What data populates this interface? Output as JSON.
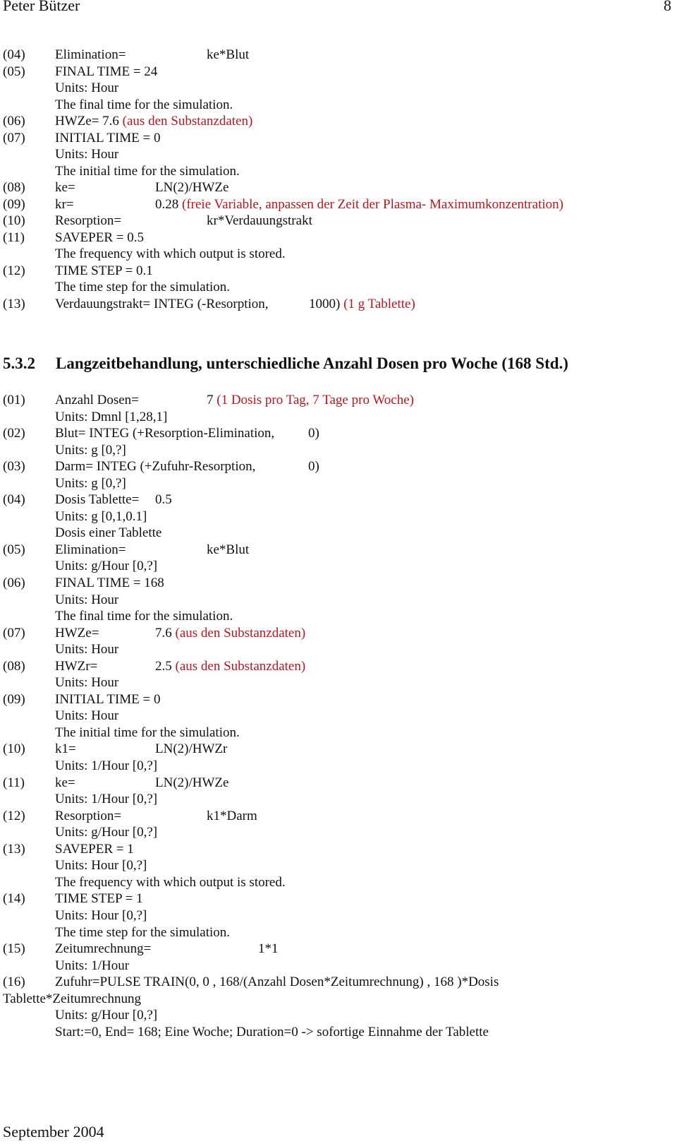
{
  "header": {
    "author": "Peter Bützer",
    "page_number": "8"
  },
  "section1": {
    "lines": [
      {
        "num": "(04)",
        "text": "Elimination=",
        "value": "ke*Blut",
        "value_col": "far",
        "note": ""
      },
      {
        "num": "(05)",
        "text": "FINAL TIME  = 24",
        "value": "",
        "note": ""
      },
      {
        "num": "",
        "text": "Units: Hour",
        "value": "",
        "note": ""
      },
      {
        "num": "",
        "text": "The final time for the simulation.",
        "value": "",
        "note": ""
      },
      {
        "num": "(06)",
        "text": "HWZe= 7.6",
        "value": "",
        "note": "(aus den Substanzdaten)"
      },
      {
        "num": "(07)",
        "text": "INITIAL TIME  = 0",
        "value": "",
        "note": ""
      },
      {
        "num": "",
        "text": "Units: Hour",
        "value": "",
        "note": ""
      },
      {
        "num": "",
        "text": "The initial time for the simulation.",
        "value": "",
        "note": ""
      },
      {
        "num": "(08)",
        "text": "ke=",
        "value": "LN(2)/HWZe",
        "value_col": "mid",
        "note": ""
      },
      {
        "num": "(09)",
        "text": "kr=",
        "value": "0.28",
        "value_col": "mid",
        "note": "(freie Variable, anpassen der Zeit der Plasma- Maximumkonzentration)"
      },
      {
        "num": "(10)",
        "text": "Resorption=",
        "value": "kr*Verdauungstrakt",
        "value_col": "far",
        "note": ""
      },
      {
        "num": "(11)",
        "text": "SAVEPER  = 0.5",
        "value": "",
        "note": ""
      },
      {
        "num": "",
        "text": "The frequency with which output is stored.",
        "value": "",
        "note": ""
      },
      {
        "num": "(12)",
        "text": "TIME STEP  = 0.1",
        "value": "",
        "note": ""
      },
      {
        "num": "",
        "text": "The time step for the simulation.",
        "value": "",
        "note": ""
      },
      {
        "num": "(13)",
        "text": "Verdauungstrakt= INTEG (-Resorption,",
        "value": "1000)",
        "value_col": "integ13",
        "note": "(1 g Tablette)"
      }
    ]
  },
  "section2": {
    "heading_number": "5.3.2",
    "heading_title": "Langzeitbehandlung, unterschiedliche Anzahl Dosen pro Woche (168 Std.)",
    "lines": [
      {
        "num": "(01)",
        "text": "Anzahl Dosen=",
        "value": "7",
        "value_col": "far",
        "note": "(1 Dosis pro Tag, 7 Tage pro Woche)"
      },
      {
        "num": "",
        "text": "Units: Dmnl [1,28,1]",
        "value": "",
        "note": ""
      },
      {
        "num": "(02)",
        "text": "Blut= INTEG (+Resorption-Elimination,",
        "value": "0)",
        "value_col": "integ",
        "note": ""
      },
      {
        "num": "",
        "text": "Units: g [0,?]",
        "value": "",
        "note": ""
      },
      {
        "num": "(03)",
        "text": "Darm= INTEG (+Zufuhr-Resorption,",
        "value": "0)",
        "value_col": "integ",
        "note": ""
      },
      {
        "num": "",
        "text": "Units: g [0,?]",
        "value": "",
        "note": ""
      },
      {
        "num": "(04)",
        "text": "Dosis Tablette=",
        "value": "0.5",
        "value_col": "dose",
        "note": ""
      },
      {
        "num": "",
        "text": "Units: g [0,1,0.1]",
        "value": "",
        "note": ""
      },
      {
        "num": "",
        "text": "Dosis einer Tablette",
        "value": "",
        "note": ""
      },
      {
        "num": "(05)",
        "text": "Elimination=",
        "value": "ke*Blut",
        "value_col": "far",
        "note": ""
      },
      {
        "num": "",
        "text": "Units: g/Hour [0,?]",
        "value": "",
        "note": ""
      },
      {
        "num": "(06)",
        "text": "FINAL TIME  = 168",
        "value": "",
        "note": ""
      },
      {
        "num": "",
        "text": "Units: Hour",
        "value": "",
        "note": ""
      },
      {
        "num": "",
        "text": "The final time for the simulation.",
        "value": "",
        "note": ""
      },
      {
        "num": "(07)",
        "text": "HWZe=",
        "value": "7.6",
        "value_col": "mid",
        "note": "(aus den Substanzdaten)"
      },
      {
        "num": "",
        "text": "Units: Hour",
        "value": "",
        "note": ""
      },
      {
        "num": "(08)",
        "text": "HWZr=",
        "value": "2.5",
        "value_col": "mid",
        "note": "(aus den Substanzdaten)"
      },
      {
        "num": "",
        "text": "Units: Hour",
        "value": "",
        "note": ""
      },
      {
        "num": "(09)",
        "text": "INITIAL TIME  = 0",
        "value": "",
        "note": ""
      },
      {
        "num": "",
        "text": "Units: Hour",
        "value": "",
        "note": ""
      },
      {
        "num": "",
        "text": "The initial time for the simulation.",
        "value": "",
        "note": ""
      },
      {
        "num": "(10)",
        "text": "k1=",
        "value": "LN(2)/HWZr",
        "value_col": "mid",
        "note": ""
      },
      {
        "num": "",
        "text": "Units: 1/Hour [0,?]",
        "value": "",
        "note": ""
      },
      {
        "num": "(11)",
        "text": "ke=",
        "value": "LN(2)/HWZe",
        "value_col": "mid",
        "note": ""
      },
      {
        "num": "",
        "text": "Units: 1/Hour [0,?]",
        "value": "",
        "note": ""
      },
      {
        "num": "(12)",
        "text": "Resorption=",
        "value": "k1*Darm",
        "value_col": "far",
        "note": ""
      },
      {
        "num": "",
        "text": "Units: g/Hour [0,?]",
        "value": "",
        "note": ""
      },
      {
        "num": "(13)",
        "text": "SAVEPER  = 1",
        "value": "",
        "note": ""
      },
      {
        "num": "",
        "text": "Units: Hour [0,?]",
        "value": "",
        "note": ""
      },
      {
        "num": "",
        "text": "The frequency with which output is stored.",
        "value": "",
        "note": ""
      },
      {
        "num": "(14)",
        "text": "TIME STEP  = 1",
        "value": "",
        "note": ""
      },
      {
        "num": "",
        "text": "Units: Hour [0,?]",
        "value": "",
        "note": ""
      },
      {
        "num": "",
        "text": "The time step for the simulation.",
        "value": "",
        "note": ""
      },
      {
        "num": "(15)",
        "text": "Zeitumrechnung=",
        "value": "1*1",
        "value_col": "zeit",
        "note": ""
      },
      {
        "num": "",
        "text": "Units: 1/Hour",
        "value": "",
        "note": ""
      },
      {
        "num": "(16)",
        "text": "Zufuhr=PULSE TRAIN(0, 0 , 168/(Anzahl Dosen*Zeitumrechnung) , 168 )*Dosis",
        "value": "",
        "note": ""
      },
      {
        "num": "",
        "text": "Tablette*Zeitumrechnung",
        "value": "",
        "note": "",
        "wrap": true
      },
      {
        "num": "",
        "text": "Units: g/Hour [0,?]",
        "value": "",
        "note": ""
      },
      {
        "num": "",
        "text": "Start:=0, End= 168; Eine Woche; Duration=0 -> sofortige Einnahme der Tablette",
        "value": "",
        "note": ""
      }
    ]
  },
  "footer": {
    "date": "September 2004"
  },
  "colors": {
    "text": "#111111",
    "annotation_red": "#c0141c"
  }
}
